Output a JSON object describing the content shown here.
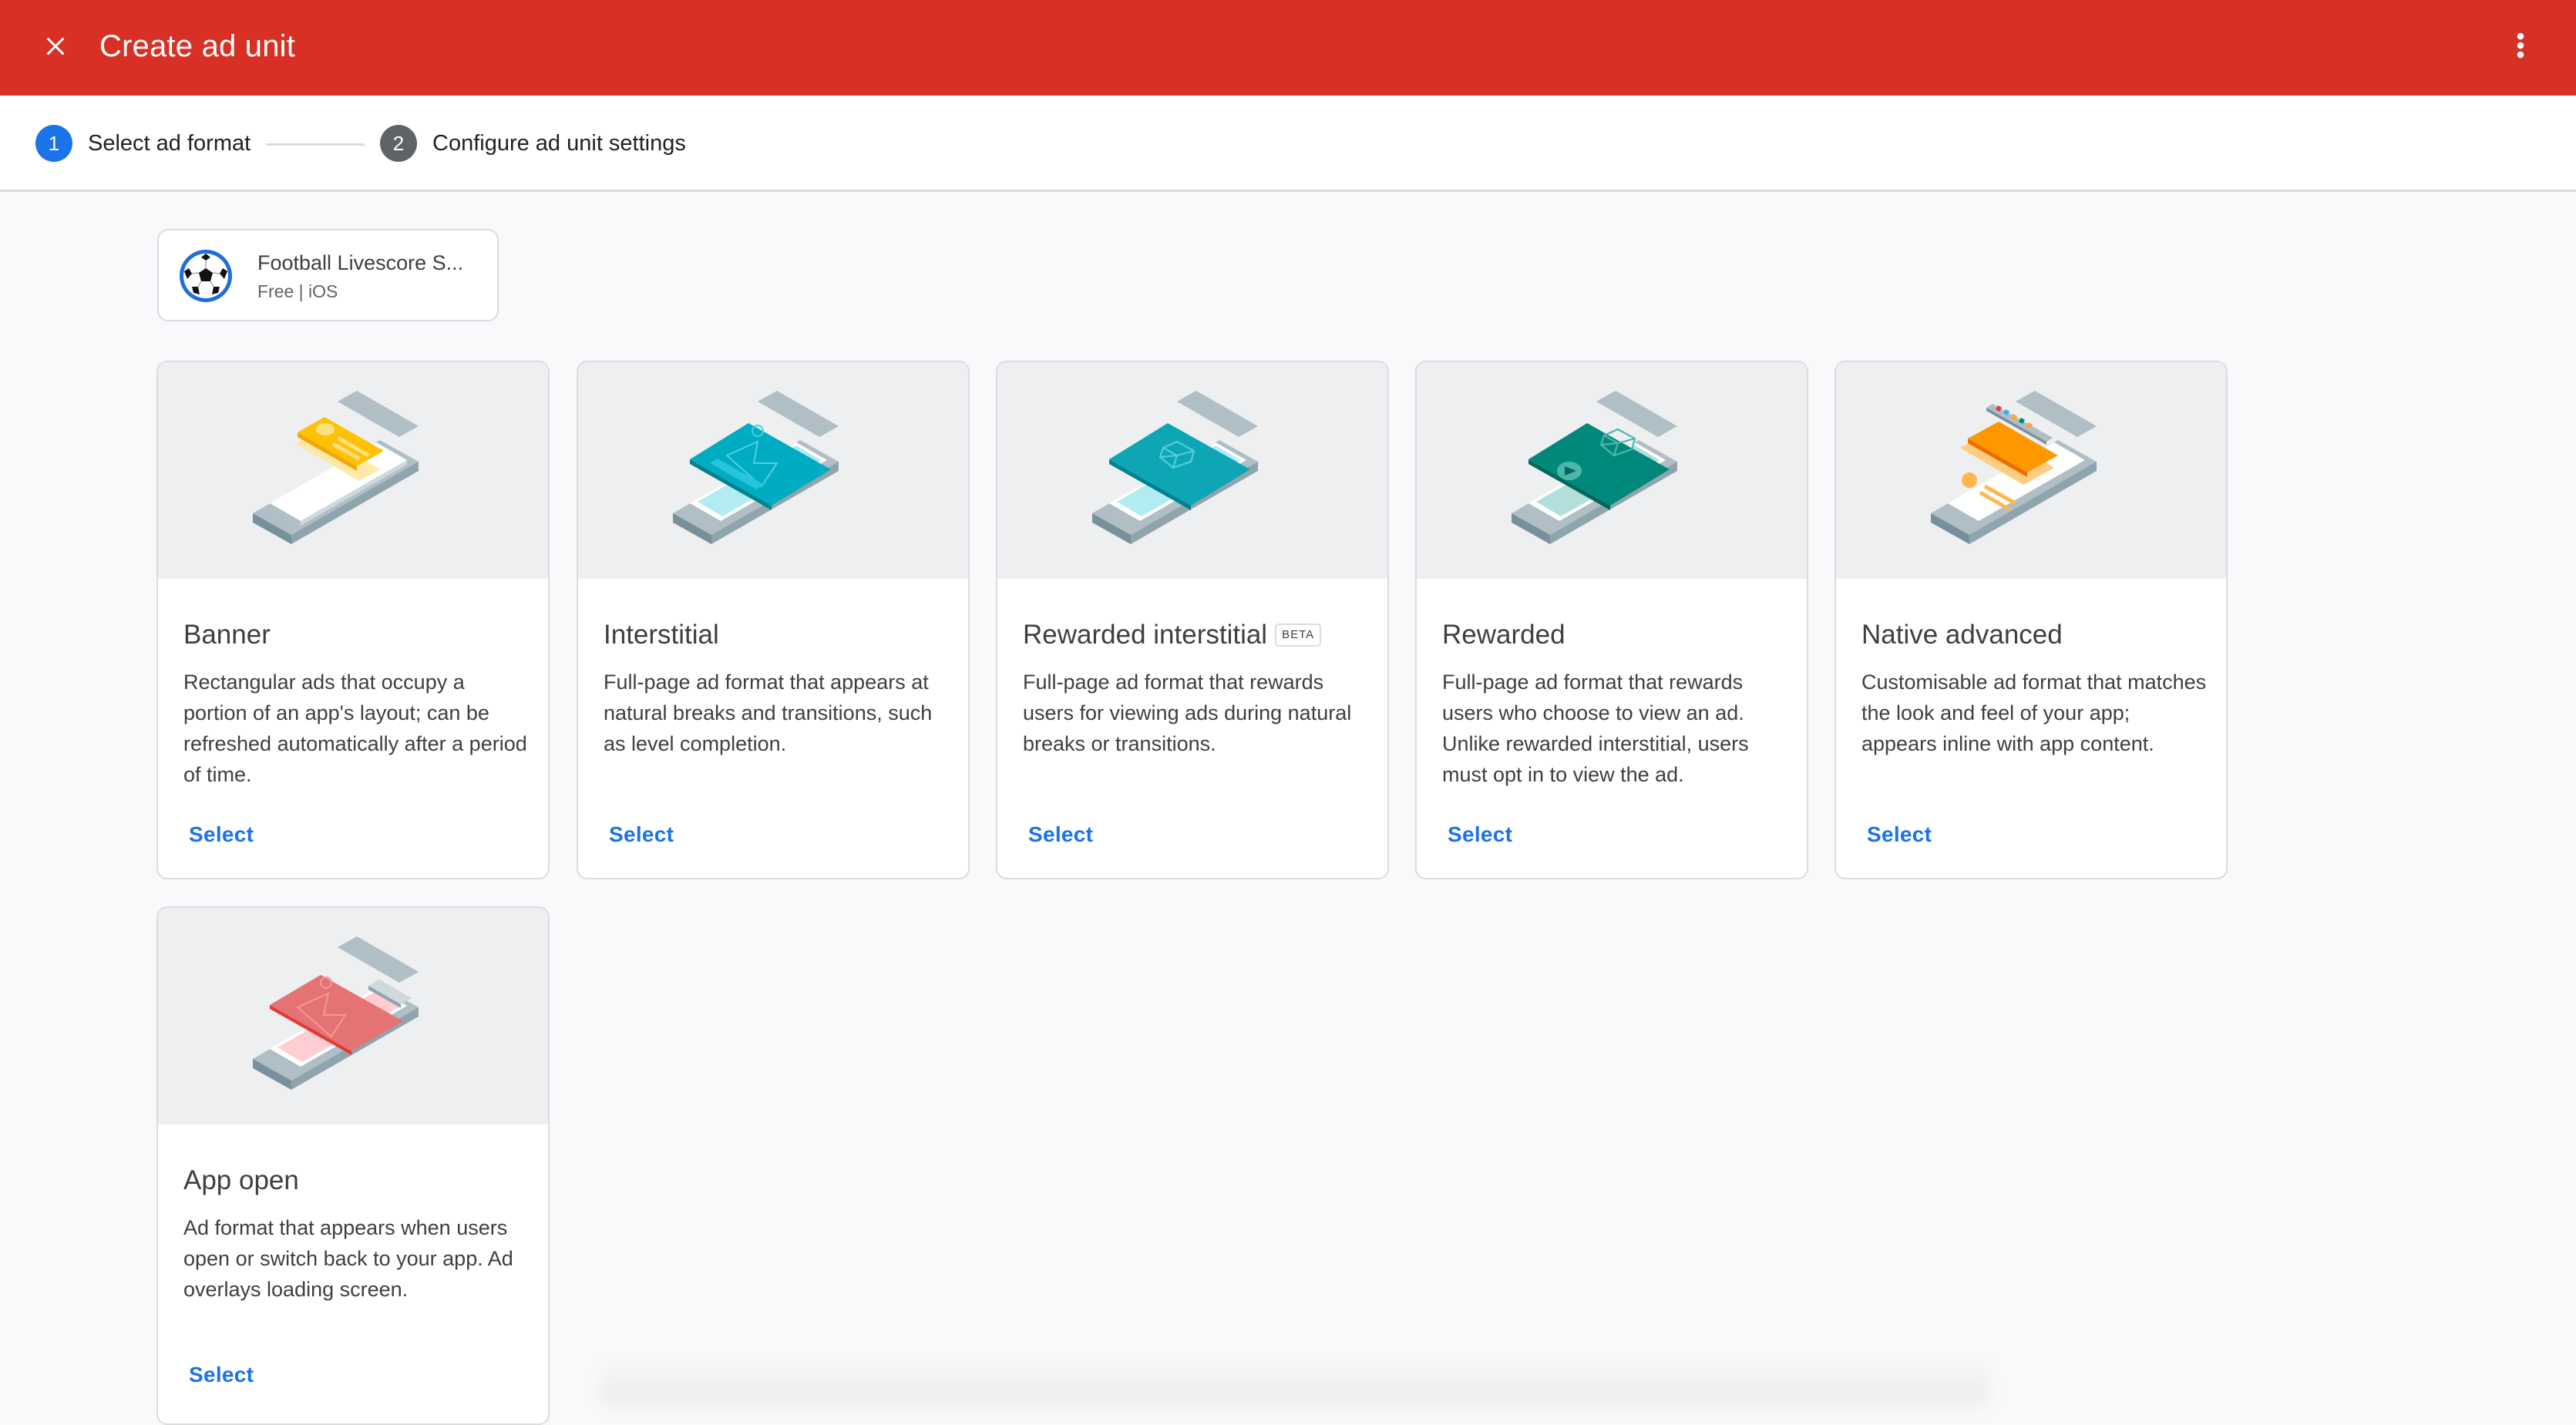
{
  "header": {
    "title": "Create ad unit",
    "close_icon": "close-icon",
    "menu_icon": "more-vert-icon",
    "brand_color": "#d93025"
  },
  "stepper": {
    "steps": [
      {
        "number": "1",
        "label": "Select ad format",
        "state": "active",
        "color": "#1a73e8"
      },
      {
        "number": "2",
        "label": "Configure ad unit settings",
        "state": "pending",
        "color": "#5f6368"
      }
    ]
  },
  "app": {
    "name": "Football Livescore S...",
    "meta": "Free | iOS",
    "icon": "soccer-ball-icon"
  },
  "formats": [
    {
      "title": "Banner",
      "badge": null,
      "description": "Rectangular ads that occupy a portion of an app's layout; can be refreshed automatically after a period of time.",
      "action": "Select",
      "illustration": "banner-illustration"
    },
    {
      "title": "Interstitial",
      "badge": null,
      "description": "Full-page ad format that appears at natural breaks and transitions, such as level completion.",
      "action": "Select",
      "illustration": "interstitial-illustration"
    },
    {
      "title": "Rewarded interstitial",
      "badge": "BETA",
      "description": "Full-page ad format that rewards users for viewing ads during natural breaks or transitions.",
      "action": "Select",
      "illustration": "rewarded-interstitial-illustration"
    },
    {
      "title": "Rewarded",
      "badge": null,
      "description": "Full-page ad format that rewards users who choose to view an ad. Unlike rewarded interstitial, users must opt in to view the ad.",
      "action": "Select",
      "illustration": "rewarded-illustration"
    },
    {
      "title": "Native advanced",
      "badge": null,
      "description": "Customisable ad format that matches the look and feel of your app; appears inline with app content.",
      "action": "Select",
      "illustration": "native-advanced-illustration"
    },
    {
      "title": "App open",
      "badge": null,
      "description": "Ad format that appears when users open or switch back to your app. Ad overlays loading screen.",
      "action": "Select",
      "illustration": "app-open-illustration"
    }
  ]
}
